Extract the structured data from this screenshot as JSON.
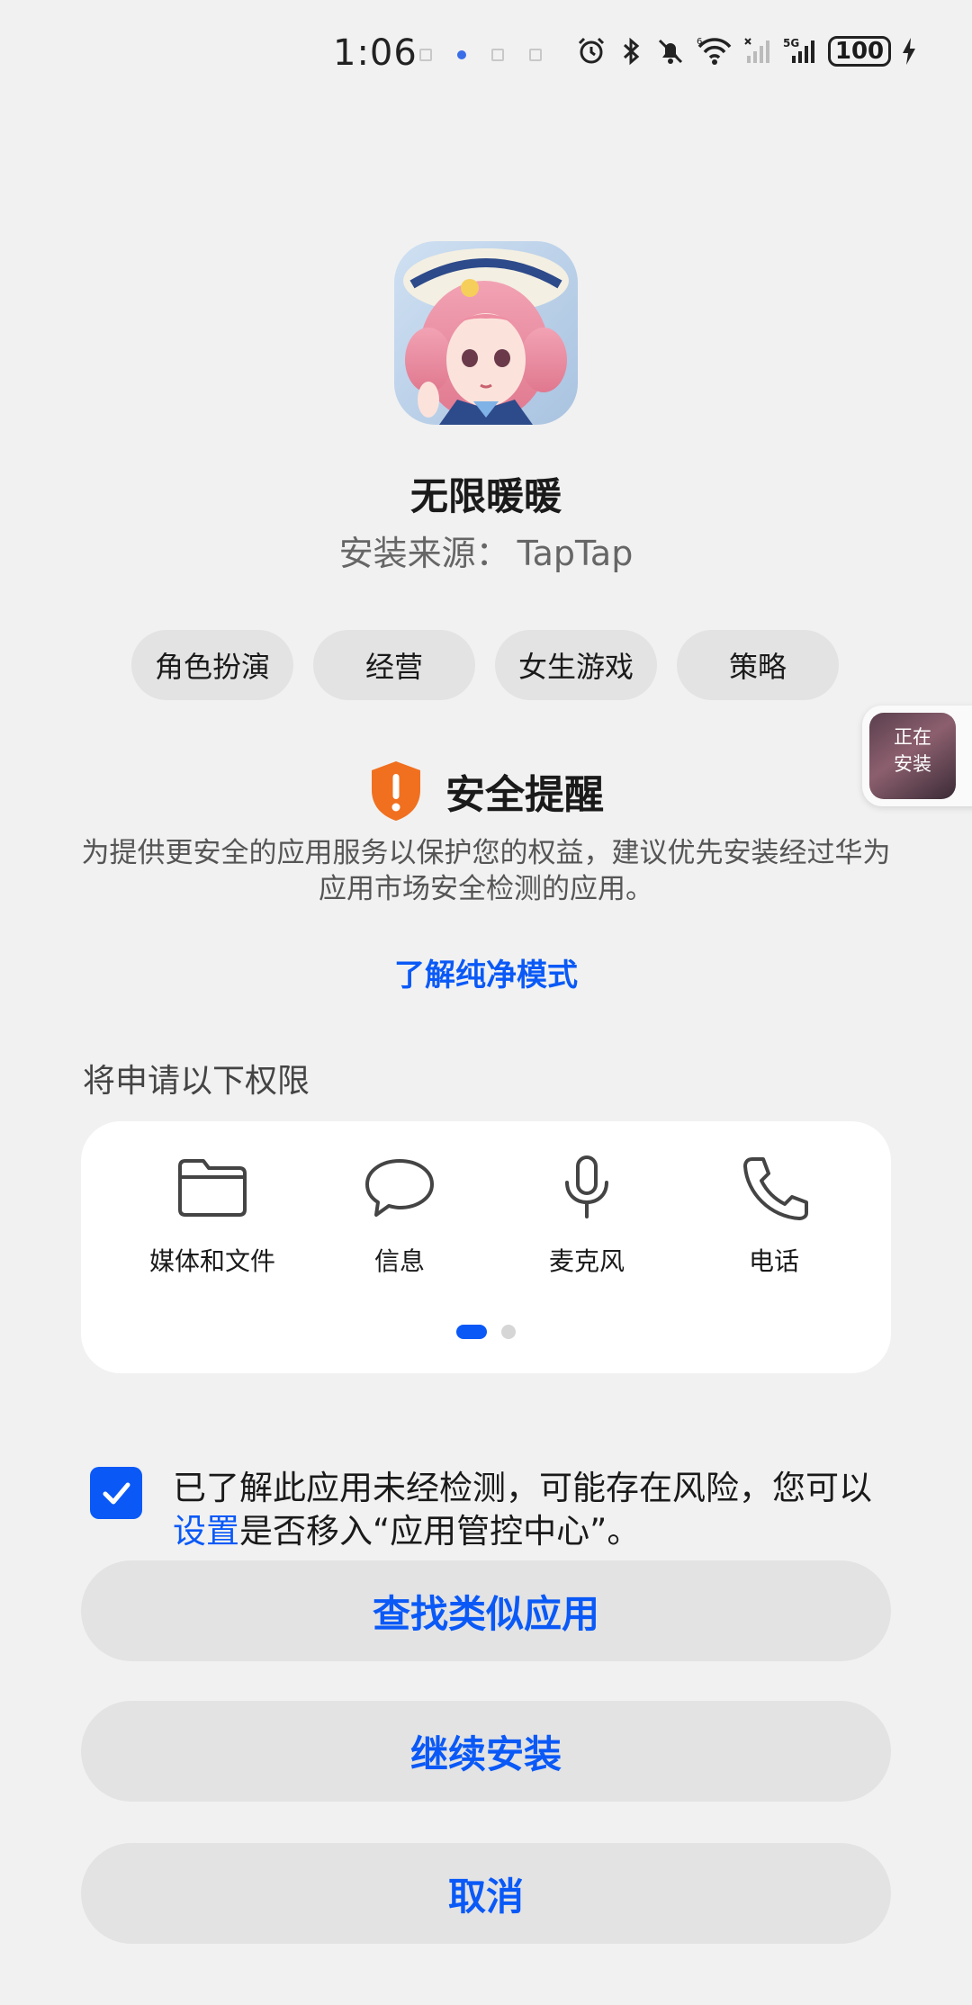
{
  "status_bar": {
    "time": "1:06",
    "signal_1_label": "6",
    "signal_2_label": "5G",
    "battery": "100"
  },
  "app": {
    "name": "无限暖暖",
    "source_label": "安装来源：",
    "source_name": "TapTap"
  },
  "tags": [
    "角色扮演",
    "经营",
    "女生游戏",
    "策略"
  ],
  "floating_chip": {
    "line1": "正在",
    "line2": "安装"
  },
  "security": {
    "title": "安全提醒",
    "description": "为提供更安全的应用服务以保护您的权益，建议优先安装经过华为应用市场安全检测的应用。",
    "link": "了解纯净模式"
  },
  "permissions": {
    "title": "将申请以下权限",
    "items": [
      {
        "icon": "folder-icon",
        "label": "媒体和文件"
      },
      {
        "icon": "message-icon",
        "label": "信息"
      },
      {
        "icon": "microphone-icon",
        "label": "麦克风"
      },
      {
        "icon": "phone-icon",
        "label": "电话"
      }
    ],
    "page_count": 2,
    "current_page": 1
  },
  "consent": {
    "checked": true,
    "text_before": "已了解此应用未经检测，可能存在风险，您可以",
    "link": "设置",
    "text_after": "是否移入“应用管控中心”。"
  },
  "buttons": {
    "find_similar": "查找类似应用",
    "continue_install": "继续安装",
    "cancel": "取消"
  },
  "colors": {
    "accent": "#0a59f7",
    "warning": "#f07020",
    "background": "#f1f1f1"
  }
}
